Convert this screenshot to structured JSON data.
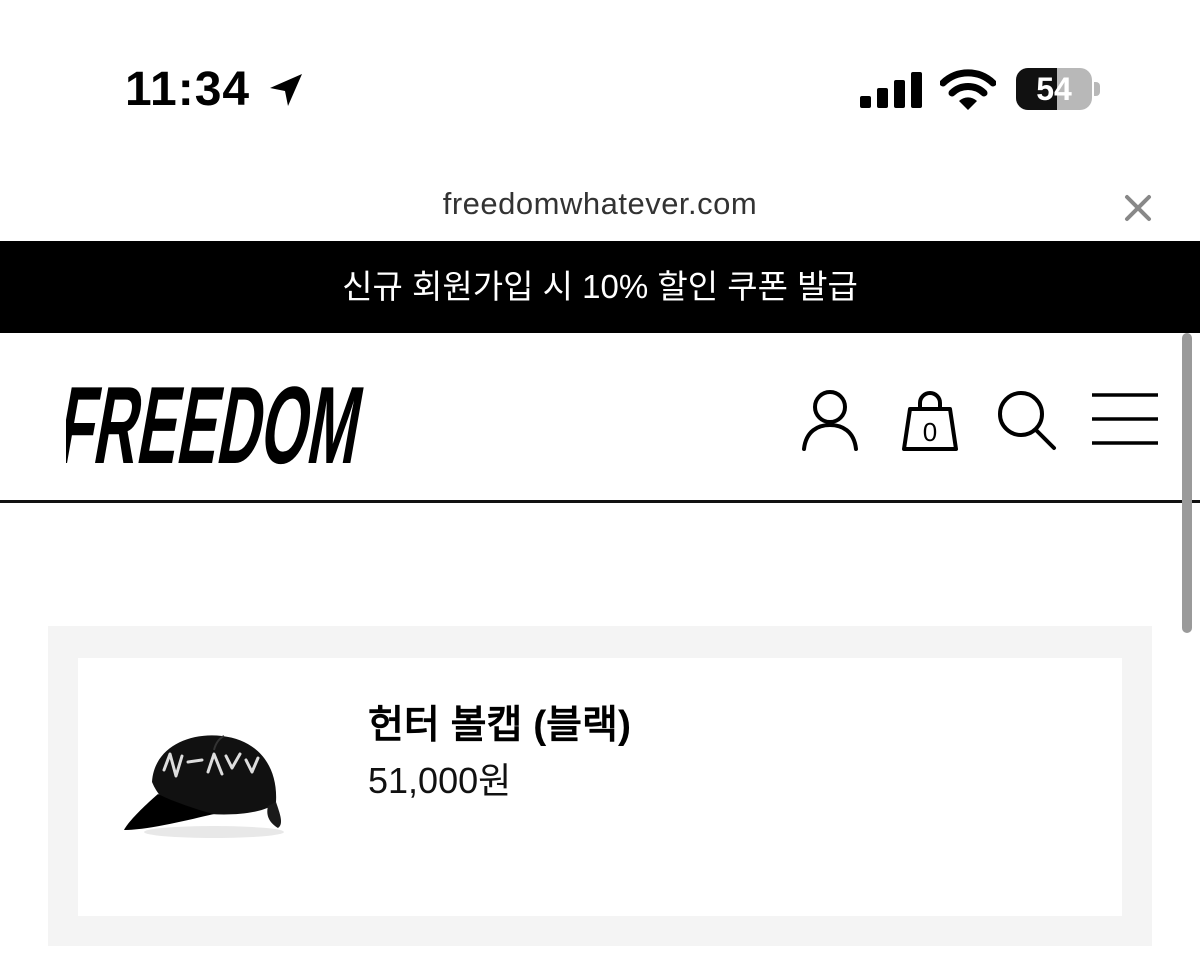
{
  "status_bar": {
    "time": "11:34",
    "battery_level": "54",
    "battery_fraction": 0.54,
    "icons": [
      "location-arrow-icon",
      "cellular-signal-icon",
      "wifi-icon",
      "battery-icon"
    ]
  },
  "browser": {
    "url": "freedomwhatever.com",
    "close_icon": "close-icon"
  },
  "promo_banner": {
    "text": "신규 회원가입 시 10% 할인 쿠폰 발급"
  },
  "header": {
    "logo_text": "FREEDOM",
    "cart_count": "0",
    "icons": [
      "user-icon",
      "shopping-bag-icon",
      "search-icon",
      "hamburger-menu-icon"
    ]
  },
  "cart": {
    "items": [
      {
        "name": "헌터 볼캡 (블랙)",
        "price": "51,000원",
        "image": "black-baseball-cap"
      }
    ]
  },
  "colors": {
    "banner_bg": "#000000",
    "banner_text": "#ffffff",
    "panel_bg": "#f4f4f4",
    "battery_fill": "#111111",
    "battery_empty": "#b8b8b8"
  }
}
